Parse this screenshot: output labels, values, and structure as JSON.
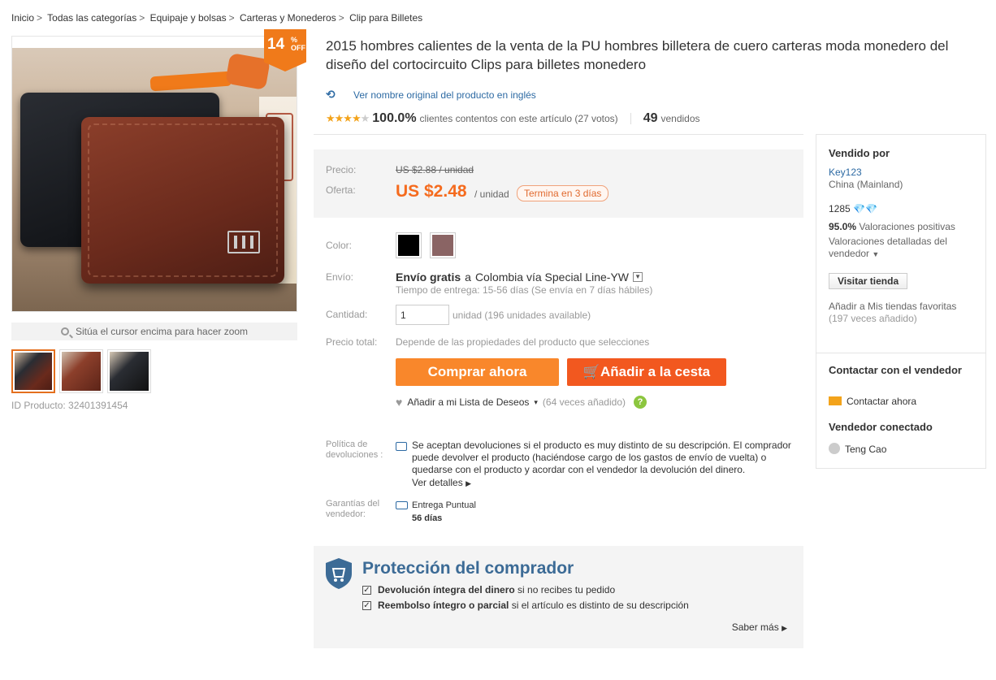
{
  "breadcrumb": [
    "Inicio",
    "Todas las categorías",
    "Equipaje y bolsas",
    "Carteras y Monederos",
    "Clip para Billetes"
  ],
  "breadcrumb_sep": ">",
  "discount": {
    "value": "14",
    "pct": "%",
    "off": "OFF"
  },
  "zoom_hint": "Sitúa el cursor encima para hacer zoom",
  "product_id": "ID Producto: 32401391454",
  "title": "2015 hombres calientes de la venta de la PU hombres billetera de cuero carteras moda monedero del diseño del cortocircuito Clips para billetes monedero",
  "original_name_link": "Ver nombre original del producto en inglés",
  "rating": {
    "stars": 4,
    "percent": "100.0%",
    "text": "clientes contentos con este artículo (27 votos)",
    "sold_num": "49",
    "sold_text": "vendidos"
  },
  "price": {
    "price_label": "Precio:",
    "old": "US $2.88 / unidad",
    "offer_label": "Oferta:",
    "new": "US $2.48",
    "unit": "/ unidad",
    "ends": "Termina en 3 días"
  },
  "color_label": "Color:",
  "colors": [
    "#000000",
    "#8a6464"
  ],
  "shipping": {
    "label": "Envío:",
    "free": "Envío gratis",
    "to": "a",
    "dest": "Colombia vía Special Line-YW",
    "time": "Tiempo de entrega: 15-56 días (Se envía en 7 días hábiles)"
  },
  "quantity": {
    "label": "Cantidad:",
    "value": "1",
    "unit": "unidad (196 unidades available)"
  },
  "total": {
    "label": "Precio total:",
    "desc": "Depende de las propiedades del producto que selecciones"
  },
  "buttons": {
    "buy": "Comprar ahora",
    "cart": "Añadir a la cesta"
  },
  "wishlist": {
    "label": "Añadir a mi Lista de Deseos",
    "count": "(64 veces añadido)",
    "help": "?"
  },
  "policy": {
    "label": "Política de devoluciones :",
    "text": "Se aceptan devoluciones si el producto es muy distinto de su descripción. El comprador puede devolver el producto (haciéndose cargo de los gastos de envío de vuelta) o quedarse con el producto y acordar con el vendedor la devolución del dinero.",
    "more": "Ver detalles"
  },
  "guarantee": {
    "label": "Garantías del vendedor:",
    "title": "Entrega Puntual",
    "days": "56 días"
  },
  "protection": {
    "title": "Protección del comprador",
    "item1_bold": "Devolución íntegra del dinero",
    "item1_rest": "si no recibes tu pedido",
    "item2_bold": "Reembolso íntegro o parcial",
    "item2_rest": "si el artículo es distinto de su descripción",
    "more": "Saber más"
  },
  "seller": {
    "heading": "Vendido por",
    "store": "Key123",
    "country": "China (Mainland)",
    "score": "1285",
    "positive_pct": "95.0%",
    "positive_text": "Valoraciones positivas",
    "detailed": "Valoraciones detalladas del vendedor",
    "visit": "Visitar tienda",
    "fav": "Añadir a Mis tiendas favoritas",
    "fav_count": "(197 veces añadido)",
    "contact_heading": "Contactar con el vendedor",
    "contact_now": "Contactar ahora",
    "online_heading": "Vendedor conectado",
    "online_name": "Teng Cao"
  }
}
